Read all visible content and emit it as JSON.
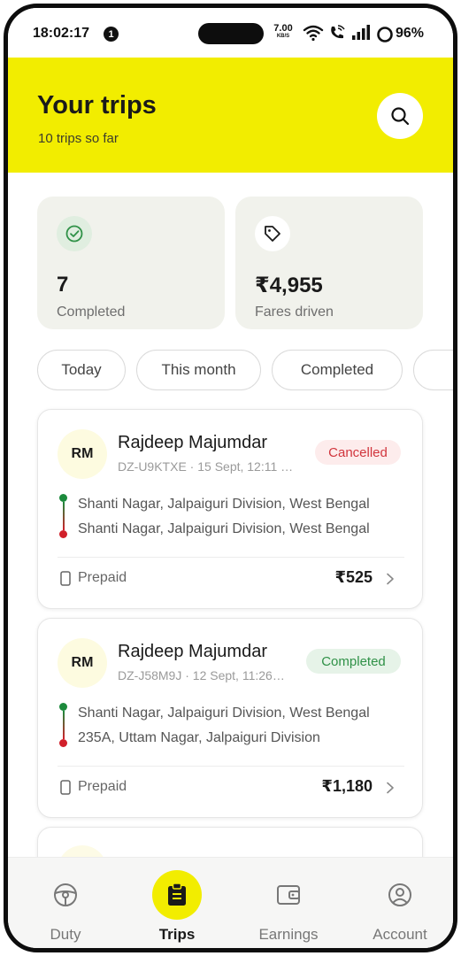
{
  "status_bar": {
    "time": "18:02:17",
    "notification_count": "1",
    "net_speed_value": "7.00",
    "net_speed_unit": "KB/S",
    "battery": "96%"
  },
  "header": {
    "title": "Your trips",
    "subtitle": "10 trips so far",
    "search_icon": "search-icon",
    "background_color": "#f2ed00"
  },
  "stats": [
    {
      "icon": "check-circle-icon",
      "value": "7",
      "label": "Completed"
    },
    {
      "icon": "tag-icon",
      "value": "₹4,955",
      "label": "Fares driven"
    }
  ],
  "filters": [
    "Today",
    "This month",
    "Completed",
    ""
  ],
  "trips": [
    {
      "initials": "RM",
      "name": "Rajdeep Majumdar",
      "meta": "DZ-U9KTXE · 15 Sept, 12:11 …",
      "status": "Cancelled",
      "pickup": "Shanti Nagar, Jalpaiguri Division, West Bengal",
      "drop": "Shanti Nagar, Jalpaiguri Division, West Bengal",
      "payment": "Prepaid",
      "fare": "₹525"
    },
    {
      "initials": "RM",
      "name": "Rajdeep Majumdar",
      "meta": "DZ-J58M9J · 12 Sept, 11:26…",
      "status": "Completed",
      "pickup": "Shanti Nagar, Jalpaiguri Division, West Bengal",
      "drop": "235A, Uttam Nagar, Jalpaiguri Division",
      "payment": "Prepaid",
      "fare": "₹1,180"
    }
  ],
  "nav": [
    {
      "label": "Duty",
      "icon": "steering-wheel-icon",
      "active": false
    },
    {
      "label": "Trips",
      "icon": "clipboard-icon",
      "active": true
    },
    {
      "label": "Earnings",
      "icon": "wallet-icon",
      "active": false
    },
    {
      "label": "Account",
      "icon": "user-circle-icon",
      "active": false
    }
  ],
  "colors": {
    "accent": "#f2ed00",
    "cancelled": "#d1353d",
    "completed": "#2f9147",
    "pickup_dot": "#1c8a3c",
    "drop_dot": "#d1202a"
  }
}
